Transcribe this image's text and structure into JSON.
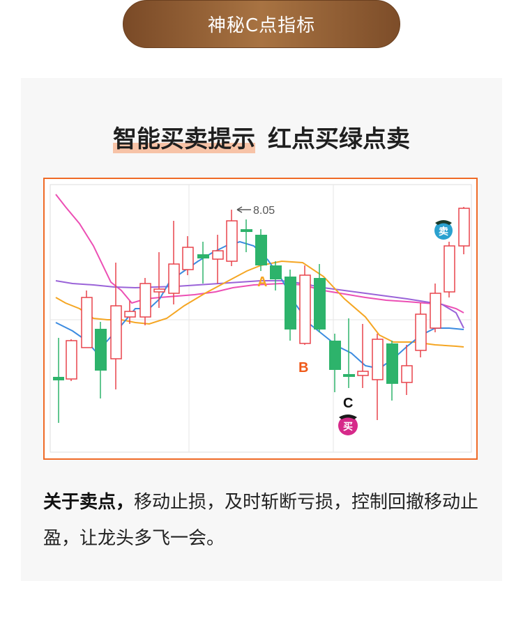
{
  "banner": {
    "title": "神秘C点指标"
  },
  "headline": {
    "highlight": "智能买卖提示",
    "rest": "红点买绿点卖"
  },
  "chart_data": {
    "type": "candlestick",
    "peak_label": "8.05",
    "points": {
      "a": "A",
      "b": "B",
      "c": "C"
    },
    "signals": {
      "sell": "卖",
      "buy": "买"
    },
    "colors": {
      "up": "#e8434b",
      "down": "#2db36b",
      "ma_blue": "#3b8be0",
      "ma_orange": "#f5a623",
      "ma_purple": "#9a63d8",
      "ma_pink": "#ec4fb4"
    }
  },
  "desc": {
    "bold": "关于卖点，",
    "text": "移动止损，及时斩断亏损，控制回撤移动止盈，让龙头多飞一会。"
  }
}
